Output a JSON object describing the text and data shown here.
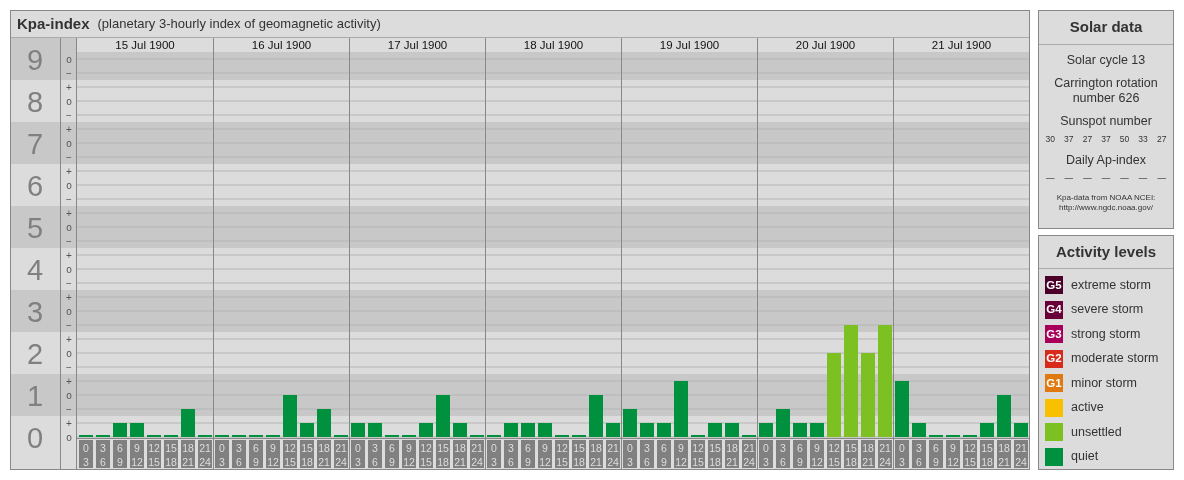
{
  "kpa_panel": {
    "subtitle": "(planetary 3-hourly index of geomagnetic activity)",
    "scale_marks": [
      "o",
      "−",
      "+",
      "o",
      "−",
      "+",
      "o",
      "−",
      "+",
      "o",
      "−",
      "+",
      "o",
      "−",
      "+",
      "o",
      "−",
      "+",
      "o",
      "−",
      "+",
      "o",
      "−",
      "+",
      "o",
      "−",
      "+",
      "o"
    ],
    "days": [
      {
        "date": "15 Jul 1900",
        "slots": [
          {
            "start": "0",
            "end": "3"
          },
          {
            "start": "3",
            "end": "6"
          },
          {
            "start": "6",
            "end": "9"
          },
          {
            "start": "9",
            "end": "12"
          },
          {
            "start": "12",
            "end": "15"
          },
          {
            "start": "15",
            "end": "18"
          },
          {
            "start": "18",
            "end": "21"
          },
          {
            "start": "21",
            "end": "24"
          }
        ]
      },
      {
        "date": "16 Jul 1900",
        "slots": [
          {
            "start": "0",
            "end": "3"
          },
          {
            "start": "3",
            "end": "6"
          },
          {
            "start": "6",
            "end": "9"
          },
          {
            "start": "9",
            "end": "12"
          },
          {
            "start": "12",
            "end": "15"
          },
          {
            "start": "15",
            "end": "18"
          },
          {
            "start": "18",
            "end": "21"
          },
          {
            "start": "21",
            "end": "24"
          }
        ]
      },
      {
        "date": "17 Jul 1900",
        "slots": [
          {
            "start": "0",
            "end": "3"
          },
          {
            "start": "3",
            "end": "6"
          },
          {
            "start": "6",
            "end": "9"
          },
          {
            "start": "9",
            "end": "12"
          },
          {
            "start": "12",
            "end": "15"
          },
          {
            "start": "15",
            "end": "18"
          },
          {
            "start": "18",
            "end": "21"
          },
          {
            "start": "21",
            "end": "24"
          }
        ]
      },
      {
        "date": "18 Jul 1900",
        "slots": [
          {
            "start": "0",
            "end": "3"
          },
          {
            "start": "3",
            "end": "6"
          },
          {
            "start": "6",
            "end": "9"
          },
          {
            "start": "9",
            "end": "12"
          },
          {
            "start": "12",
            "end": "15"
          },
          {
            "start": "15",
            "end": "18"
          },
          {
            "start": "18",
            "end": "21"
          },
          {
            "start": "21",
            "end": "24"
          }
        ]
      },
      {
        "date": "19 Jul 1900",
        "slots": [
          {
            "start": "0",
            "end": "3"
          },
          {
            "start": "3",
            "end": "6"
          },
          {
            "start": "6",
            "end": "9"
          },
          {
            "start": "9",
            "end": "12"
          },
          {
            "start": "12",
            "end": "15"
          },
          {
            "start": "15",
            "end": "18"
          },
          {
            "start": "18",
            "end": "21"
          },
          {
            "start": "21",
            "end": "24"
          }
        ]
      },
      {
        "date": "20 Jul 1900",
        "slots": [
          {
            "start": "0",
            "end": "3"
          },
          {
            "start": "3",
            "end": "6"
          },
          {
            "start": "6",
            "end": "9"
          },
          {
            "start": "9",
            "end": "12"
          },
          {
            "start": "12",
            "end": "15"
          },
          {
            "start": "15",
            "end": "18"
          },
          {
            "start": "18",
            "end": "21"
          },
          {
            "start": "21",
            "end": "24"
          }
        ]
      },
      {
        "date": "21 Jul 1900",
        "slots": [
          {
            "start": "0",
            "end": "3"
          },
          {
            "start": "3",
            "end": "6"
          },
          {
            "start": "6",
            "end": "9"
          },
          {
            "start": "9",
            "end": "12"
          },
          {
            "start": "12",
            "end": "15"
          },
          {
            "start": "15",
            "end": "18"
          },
          {
            "start": "18",
            "end": "21"
          },
          {
            "start": "21",
            "end": "24"
          }
        ]
      }
    ],
    "chart_data": {
      "type": "bar",
      "title": "Kpa-index",
      "grid": true,
      "ylim": [
        0,
        9.17
      ],
      "yticks": [
        0,
        1,
        2,
        3,
        4,
        5,
        6,
        7,
        8,
        9
      ],
      "series": [
        {
          "values": [
            0,
            0,
            0.33,
            0.33,
            0,
            0,
            0.67,
            0,
            0,
            0,
            0,
            0,
            1,
            0.33,
            0.67,
            0,
            0.33,
            0.33,
            0,
            0,
            0.33,
            1,
            0.33,
            0,
            0,
            0.33,
            0.33,
            0.33,
            0,
            0,
            1,
            0.33,
            0.67,
            0.33,
            0.33,
            1.33,
            0,
            0.33,
            0.33,
            0,
            0.33,
            0.67,
            0.33,
            0.33,
            2,
            2.67,
            2,
            2.67,
            1.33,
            0.33,
            0,
            0,
            0,
            0.33,
            1,
            0.33
          ]
        }
      ]
    }
  },
  "solar_data": {
    "title": "Solar data",
    "solar_cycle": "Solar cycle 13",
    "carrington": "Carrington rotation number 626",
    "sunspot_title": "Sunspot number",
    "sunspot_numbers": [
      "30",
      "37",
      "27",
      "37",
      "50",
      "33",
      "27"
    ],
    "ap_title": "Daily Ap-index",
    "ap_values": [
      "—",
      "—",
      "—",
      "—",
      "—",
      "—",
      "—"
    ],
    "source_note": "Kpa-data from NOAA NCEI:",
    "source_url": "http://www.ngdc.noaa.gov/"
  },
  "activity_levels": {
    "title": "Activity levels",
    "items": [
      {
        "code": "G5",
        "label": "extreme storm",
        "color": "#4a0028"
      },
      {
        "code": "G4",
        "label": "severe storm",
        "color": "#6a0038"
      },
      {
        "code": "G3",
        "label": "strong storm",
        "color": "#a8005a"
      },
      {
        "code": "G2",
        "label": "moderate storm",
        "color": "#d82a1a"
      },
      {
        "code": "G1",
        "label": "minor storm",
        "color": "#e07a10"
      },
      {
        "label": "active",
        "color": "#f8c000"
      },
      {
        "label": "unsettled",
        "color": "#7cc022"
      },
      {
        "label": "quiet",
        "color": "#00913f"
      }
    ]
  }
}
